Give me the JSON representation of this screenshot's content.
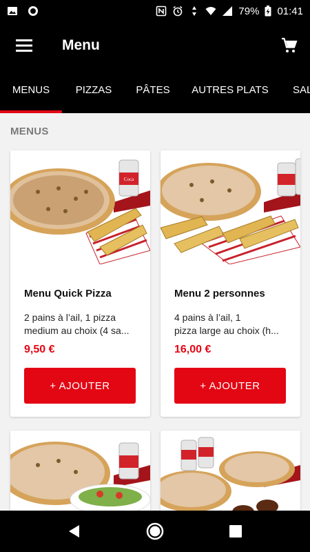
{
  "status_bar": {
    "battery": "79%",
    "time": "01:41",
    "icons": [
      "image-icon",
      "circle-icon",
      "nfc-icon",
      "alarm-icon",
      "data-arrows-icon",
      "wifi-icon",
      "signal-icon",
      "battery-charging-icon"
    ]
  },
  "app_bar": {
    "title": "Menu",
    "menu_icon": "hamburger-icon",
    "cart_icon": "cart-icon"
  },
  "tabs": [
    {
      "label": "MENUS",
      "active": true
    },
    {
      "label": "PIZZAS",
      "active": false
    },
    {
      "label": "PÂTES",
      "active": false
    },
    {
      "label": "AUTRES PLATS",
      "active": false
    },
    {
      "label": "SAL",
      "active": false
    }
  ],
  "section": {
    "title": "MENUS"
  },
  "products": [
    {
      "name": "Menu Quick Pizza",
      "desc_line1": "2 pains à l’ail, 1 pizza",
      "desc_line2": "medium au choix (4 sa...",
      "price": "9,50 €",
      "button": "+ AJOUTER"
    },
    {
      "name": "Menu 2 personnes",
      "desc_line1": "4 pains à l’ail, 1",
      "desc_line2": "pizza large au choix (h...",
      "price": "16,00 €",
      "button": "+ AJOUTER"
    }
  ],
  "colors": {
    "accent": "#e30613",
    "bar_bg": "#000000",
    "page_bg": "#f2f2f2"
  },
  "nav_bar": {
    "icons": [
      "back-icon",
      "home-icon",
      "recents-icon"
    ]
  }
}
